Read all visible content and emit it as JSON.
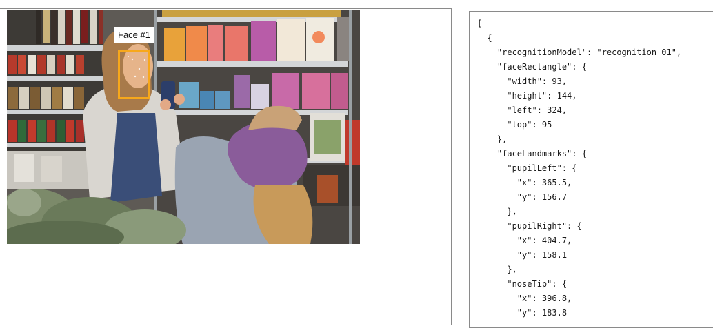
{
  "face_detection": {
    "face_label": "Face #1",
    "box_color": "#f7a81b"
  },
  "photo": {
    "scene": "grocery-store-aisle"
  },
  "json_output": {
    "lines": [
      "[",
      "  {",
      "    \"recognitionModel\": \"recognition_01\",",
      "    \"faceRectangle\": {",
      "      \"width\": 93,",
      "      \"height\": 144,",
      "      \"left\": 324,",
      "      \"top\": 95",
      "    },",
      "    \"faceLandmarks\": {",
      "      \"pupilLeft\": {",
      "        \"x\": 365.5,",
      "        \"y\": 156.7",
      "      },",
      "      \"pupilRight\": {",
      "        \"x\": 404.7,",
      "        \"y\": 158.1",
      "      },",
      "      \"noseTip\": {",
      "        \"x\": 396.8,",
      "        \"y\": 183.8"
    ]
  }
}
